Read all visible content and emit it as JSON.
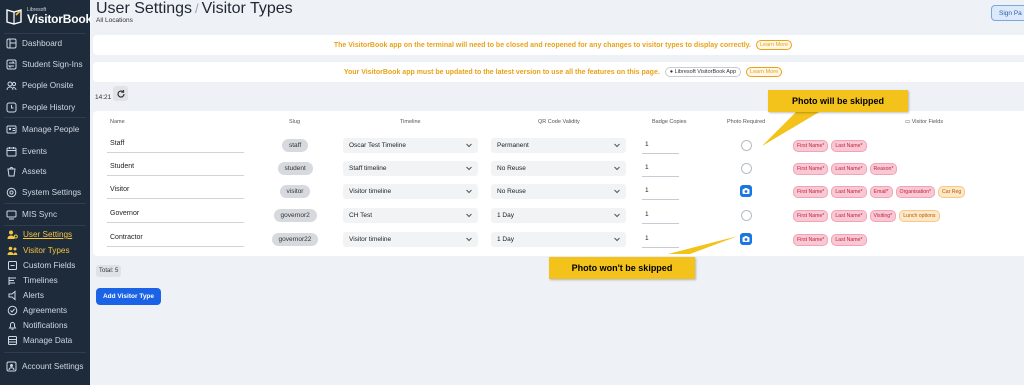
{
  "sidebar": {
    "logo_small": "Libresoft",
    "logo_big": "VisitorBook",
    "items": [
      {
        "label": "Dashboard",
        "icon": "dashboard-icon"
      },
      {
        "label": "Student Sign-Ins",
        "icon": "swap-icon"
      },
      {
        "label": "People Onsite",
        "icon": "people-icon"
      },
      {
        "label": "People History",
        "icon": "history-icon"
      },
      {
        "label": "Manage People",
        "icon": "id-card-icon"
      },
      {
        "label": "Events",
        "icon": "calendar-icon"
      },
      {
        "label": "Assets",
        "icon": "assets-icon"
      },
      {
        "label": "System Settings",
        "icon": "settings-icon"
      },
      {
        "label": "MIS Sync",
        "icon": "sync-icon"
      },
      {
        "label": "User Settings",
        "icon": "user-settings-icon"
      },
      {
        "label": "Visitor Types",
        "icon": "visitor-types-icon"
      },
      {
        "label": "Custom Fields",
        "icon": "custom-fields-icon"
      },
      {
        "label": "Timelines",
        "icon": "timelines-icon"
      },
      {
        "label": "Alerts",
        "icon": "alerts-icon"
      },
      {
        "label": "Agreements",
        "icon": "agreements-icon"
      },
      {
        "label": "Notifications",
        "icon": "bell-icon"
      },
      {
        "label": "Manage Data",
        "icon": "data-icon"
      },
      {
        "label": "Account Settings",
        "icon": "account-icon"
      }
    ]
  },
  "header": {
    "title": "User Settings",
    "separator": "/",
    "subtitle_page": "Visitor Types",
    "location": "All Locations",
    "signout_label": "Sign Pa"
  },
  "notices": {
    "restart": "The VisitorBook app on the terminal will need to be closed and reopened for any changes to visitor types to display correctly.",
    "update": "Your VisitorBook app must be updated to the latest version to use all the features on this page.",
    "app_pill": "Libresoft VisitorBook App",
    "learn_more": "Learn More"
  },
  "time": "14:21",
  "table": {
    "headers": [
      "Name",
      "Slug",
      "Timeline",
      "QR Code Validity",
      "Badge Copies",
      "Photo Required",
      "Visitor Fields"
    ],
    "rows": [
      {
        "name": "Staff",
        "slug": "staff",
        "timeline": "Oscar Test Timeline",
        "qr": "Permanent",
        "copies": "1",
        "photo": false,
        "fields": [
          "First Name",
          "Last Name"
        ]
      },
      {
        "name": "Student",
        "slug": "student",
        "timeline": "Staff timeline",
        "qr": "No Reuse",
        "copies": "1",
        "photo": false,
        "fields": [
          "First Name",
          "Last Name",
          "Reason"
        ]
      },
      {
        "name": "Visitor",
        "slug": "visitor",
        "timeline": "Visitor timeline",
        "qr": "No Reuse",
        "copies": "1",
        "photo": true,
        "fields": [
          "First Name",
          "Last Name",
          "Email",
          "Organisation"
        ],
        "opt": [
          "Car Reg"
        ]
      },
      {
        "name": "Governor",
        "slug": "governor2",
        "timeline": "CH Test",
        "qr": "1 Day",
        "copies": "1",
        "photo": false,
        "fields": [
          "First Name",
          "Last Name",
          "Visiting"
        ],
        "opt": [
          "Lunch options"
        ]
      },
      {
        "name": "Contractor",
        "slug": "governor22",
        "timeline": "Visitor timeline",
        "qr": "1 Day",
        "copies": "1",
        "photo": true,
        "fields": [
          "First Name",
          "Last Name"
        ]
      }
    ],
    "required_mark": "*",
    "total": "Total: 5"
  },
  "add_button": "Add Visitor Type",
  "callouts": {
    "skipped": "Photo will be skipped",
    "not_skipped": "Photo won't be skipped"
  },
  "colors": {
    "sidebar_bg": "#1e2b3a",
    "accent_active": "#f5c542",
    "primary_button": "#1b63e6",
    "notice_text": "#e8a21a",
    "callout": "#f3c21b",
    "required_pill": "#f8c9d4"
  }
}
